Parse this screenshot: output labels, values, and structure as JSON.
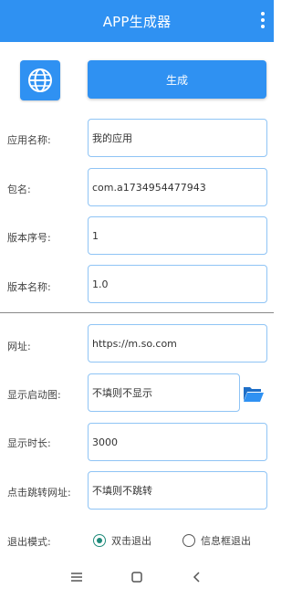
{
  "appbar": {
    "title": "APP生成器",
    "menu_icon": "more-vert-icon"
  },
  "header": {
    "globe_icon": "globe-icon",
    "generate_label": "生成"
  },
  "form": {
    "app_name": {
      "label": "应用名称:",
      "value": "我的应用"
    },
    "package": {
      "label": "包名:",
      "value": "com.a1734954477943"
    },
    "version_code": {
      "label": "版本序号:",
      "value": "1"
    },
    "version_name": {
      "label": "版本名称:",
      "value": "1.0"
    },
    "url": {
      "label": "网址:",
      "value": "https://m.so.com"
    },
    "splash": {
      "label": "显示启动图:",
      "value": "不填则不显示",
      "folder_icon": "folder-open-icon"
    },
    "duration": {
      "label": "显示时长:",
      "value": "3000"
    },
    "click_url": {
      "label": "点击跳转网址:",
      "value": "不填则不跳转"
    },
    "exit_mode": {
      "label": "退出模式:",
      "options": [
        {
          "label": "双击退出",
          "selected": true
        },
        {
          "label": "信息框退出",
          "selected": false
        }
      ]
    }
  },
  "navbar": {
    "menu_icon": "recent-apps-icon",
    "home_icon": "home-icon",
    "back_icon": "back-icon"
  },
  "colors": {
    "primary": "#2f91f2",
    "field_border": "#8fc4f5",
    "radio_selected": "#1e8a7a"
  }
}
